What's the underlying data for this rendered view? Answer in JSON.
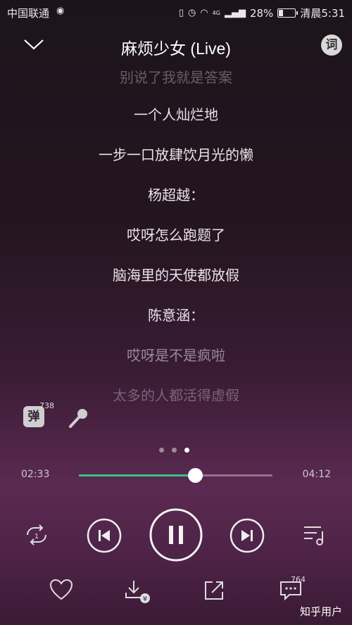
{
  "status_bar": {
    "carrier": "中国联通",
    "network": "4G",
    "battery": "28%",
    "battery_level": 0.28,
    "time": "清晨5:31"
  },
  "header": {
    "title": "麻烦少女 (Live)",
    "lyric_button_label": "词"
  },
  "lyrics": [
    "别说了我就是答案",
    "一个人灿烂地",
    "一步一口放肆饮月光的懒",
    "杨超越：",
    "哎呀怎么跑题了",
    "脑海里的天使都放假",
    "陈意涵：",
    "哎呀是不是疯啦",
    "太多的人都活得虚假"
  ],
  "tools": {
    "danmu_label": "弹",
    "danmu_count": "738"
  },
  "pager": {
    "count": 3,
    "active": 2
  },
  "player": {
    "current_time": "02:33",
    "total_time": "04:12",
    "progress": 0.6,
    "repeat_mode_number": "1"
  },
  "bottom": {
    "comment_count": "764",
    "watermark": "知乎用户"
  },
  "colors": {
    "progress_fill": "#37c384",
    "background_top": "#1d141b",
    "background_bottom": "#5b2a52"
  }
}
